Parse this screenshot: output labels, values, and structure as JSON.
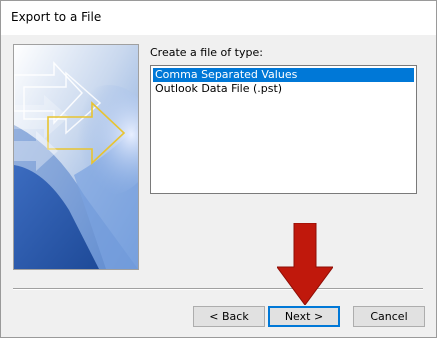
{
  "window": {
    "title": "Export to a File"
  },
  "dialog": {
    "prompt": "Create a file of type:",
    "file_types": [
      {
        "label": "Comma Separated Values",
        "selected": true
      },
      {
        "label": "Outlook Data File (.pst)",
        "selected": false
      }
    ]
  },
  "buttons": {
    "back": "< Back",
    "next": "Next >",
    "cancel": "Cancel"
  },
  "colors": {
    "selection": "#0078d7",
    "annotation_arrow": "#c0180c",
    "default_button_border": "#0078d7"
  },
  "icons": {
    "banner": "wizard-banner-arrows",
    "annotation": "red-down-arrow-icon"
  }
}
